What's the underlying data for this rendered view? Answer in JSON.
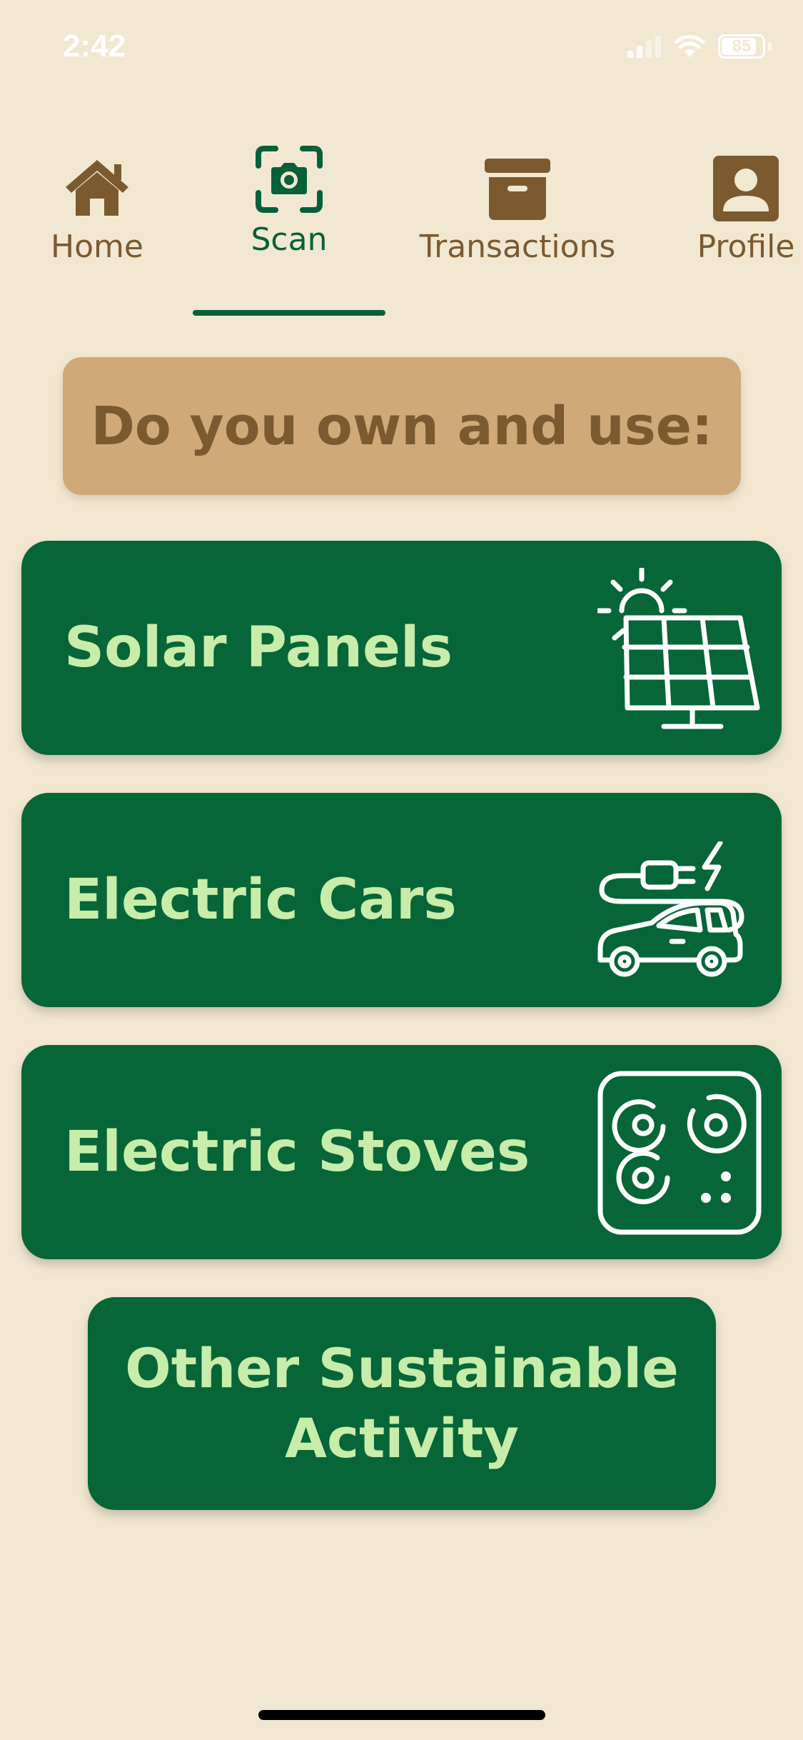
{
  "status_bar": {
    "time": "2:42",
    "battery": "85",
    "battery_fraction": 0.85
  },
  "tabs": [
    {
      "label": "Home",
      "icon": "home-icon",
      "active": false
    },
    {
      "label": "Scan",
      "icon": "camera-scan-icon",
      "active": true
    },
    {
      "label": "Transactions",
      "icon": "archive-box-icon",
      "active": false
    },
    {
      "label": "Profile",
      "icon": "profile-icon",
      "active": false
    }
  ],
  "question": "Do you own and use:",
  "options": [
    {
      "label": "Solar Panels",
      "icon": "solar-panel-icon"
    },
    {
      "label": "Electric Cars",
      "icon": "electric-car-icon"
    },
    {
      "label": "Electric Stoves",
      "icon": "electric-stove-icon"
    }
  ],
  "other_option": {
    "line1": "Other Sustainable",
    "line2": "Activity"
  },
  "colors": {
    "background": "#f2e8d2",
    "brown": "#7b5a30",
    "tan": "#cfaa78",
    "green": "#066638",
    "light_green": "#c8ecaa"
  }
}
